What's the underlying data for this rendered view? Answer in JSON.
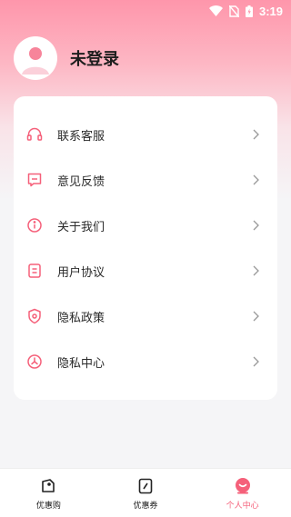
{
  "status": {
    "time": "3:19"
  },
  "profile": {
    "name": "未登录"
  },
  "menu": {
    "items": [
      {
        "label": "联系客服",
        "icon": "headset-icon"
      },
      {
        "label": "意见反馈",
        "icon": "feedback-icon"
      },
      {
        "label": "关于我们",
        "icon": "info-icon"
      },
      {
        "label": "用户协议",
        "icon": "document-icon"
      },
      {
        "label": "隐私政策",
        "icon": "shield-icon"
      },
      {
        "label": "隐私中心",
        "icon": "compass-icon"
      }
    ]
  },
  "tabs": [
    {
      "label": "优惠购",
      "icon": "shopping-bag-icon",
      "active": false
    },
    {
      "label": "优惠券",
      "icon": "coupon-icon",
      "active": false
    },
    {
      "label": "个人中心",
      "icon": "profile-icon",
      "active": true
    }
  ],
  "colors": {
    "accent": "#f5607a",
    "header": "#fe96ab",
    "background": "#f5f5f7"
  }
}
